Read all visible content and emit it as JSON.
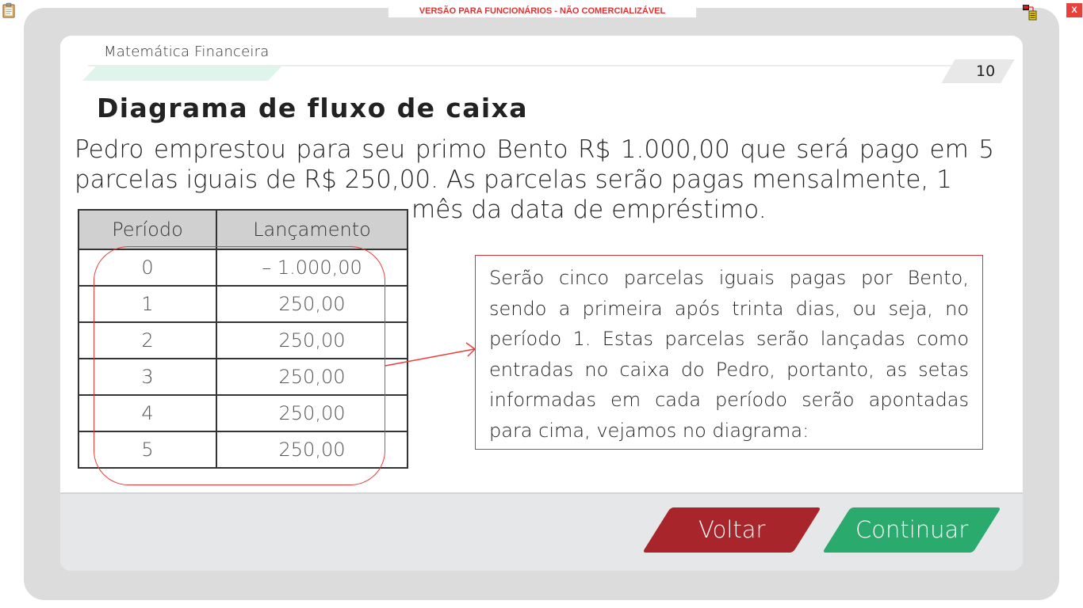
{
  "topbar": {
    "banner": "VERSÃO PARA FUNCIONÁRIOS - NÃO COMERCIALIZÁVEL",
    "close_label": "X",
    "icons": [
      "clipboard-icon",
      "network-status-icon"
    ]
  },
  "header": {
    "course": "Matemática Financeira",
    "page": "10"
  },
  "main": {
    "heading": "Diagrama de fluxo de caixa",
    "paragraph_lines": [
      "Pedro emprestou para seu primo Bento R$ 1.000,00 que será pago em 5",
      "parcelas iguais de R$ 250,00. As parcelas serão pagas mensalmente, 1",
      "mês   da data de empréstimo."
    ],
    "table": {
      "headers": [
        "Período",
        "Lançamento"
      ],
      "rows": [
        [
          "0",
          "– 1.000,00"
        ],
        [
          "1",
          "250,00"
        ],
        [
          "2",
          "250,00"
        ],
        [
          "3",
          "250,00"
        ],
        [
          "4",
          "250,00"
        ],
        [
          "5",
          "250,00"
        ]
      ]
    },
    "callout": "Serão cinco parcelas iguais pagas por Bento, sendo a primeira após trinta dias, ou seja, no período 1. Estas parcelas serão lançadas como entradas no caixa do Pedro, portanto, as setas informadas em cada período serão apontadas para cima, vejamos no diagrama:"
  },
  "nav": {
    "back_label": "Voltar",
    "next_label": "Continuar"
  },
  "colors": {
    "back_button": "#a8262b",
    "next_button": "#2aaa6c",
    "annotation_red": "#ee3b3b",
    "banner_text": "#e03030"
  }
}
